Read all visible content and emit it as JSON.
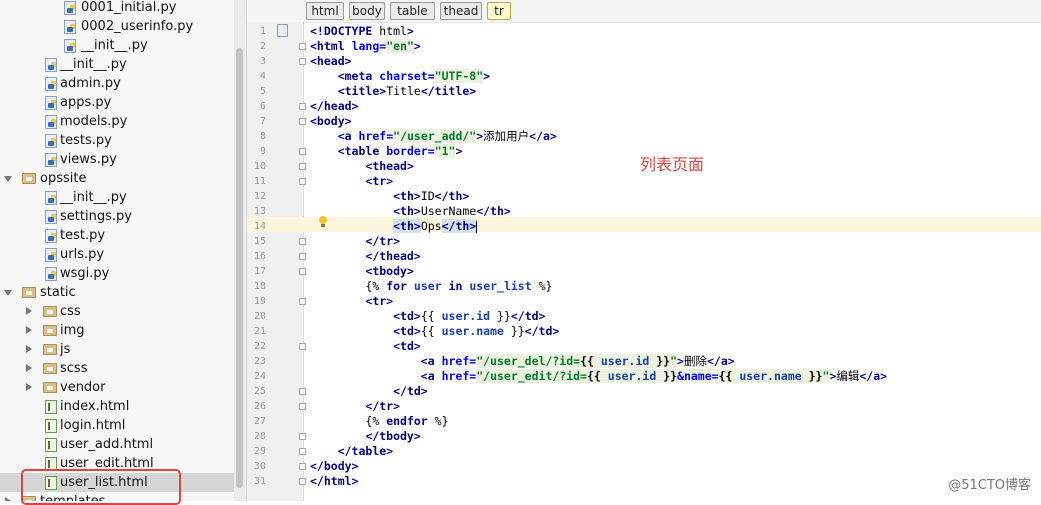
{
  "tree": {
    "items": [
      {
        "label": "0001_initial.py",
        "type": "py"
      },
      {
        "label": "0002_userinfo.py",
        "type": "py"
      },
      {
        "label": "__init__.py",
        "type": "py"
      },
      {
        "label": "__init__.py",
        "type": "py"
      },
      {
        "label": "admin.py",
        "type": "py"
      },
      {
        "label": "apps.py",
        "type": "py"
      },
      {
        "label": "models.py",
        "type": "py"
      },
      {
        "label": "tests.py",
        "type": "py"
      },
      {
        "label": "views.py",
        "type": "py"
      },
      {
        "label": "opssite",
        "type": "folder",
        "expanded": true
      },
      {
        "label": "__init__.py",
        "type": "py"
      },
      {
        "label": "settings.py",
        "type": "py"
      },
      {
        "label": "test.py",
        "type": "py"
      },
      {
        "label": "urls.py",
        "type": "py"
      },
      {
        "label": "wsgi.py",
        "type": "py"
      },
      {
        "label": "static",
        "type": "folder",
        "expanded": true
      },
      {
        "label": "css",
        "type": "folder",
        "expanded": false
      },
      {
        "label": "img",
        "type": "folder",
        "expanded": false
      },
      {
        "label": "js",
        "type": "folder",
        "expanded": false
      },
      {
        "label": "scss",
        "type": "folder",
        "expanded": false
      },
      {
        "label": "vendor",
        "type": "folder",
        "expanded": false
      },
      {
        "label": "index.html",
        "type": "html"
      },
      {
        "label": "login.html",
        "type": "html"
      },
      {
        "label": "user_add.html",
        "type": "html"
      },
      {
        "label": "user_edit.html",
        "type": "html"
      },
      {
        "label": "user_list.html",
        "type": "html",
        "selected": true
      },
      {
        "label": "templates",
        "type": "folder",
        "expanded": false
      }
    ]
  },
  "breadcrumbs": [
    "html",
    "body",
    "table",
    "thead",
    "tr"
  ],
  "editor": {
    "line_numbers": [
      "1",
      "2",
      "3",
      "4",
      "5",
      "6",
      "7",
      "8",
      "9",
      "10",
      "11",
      "12",
      "13",
      "14",
      "15",
      "16",
      "17",
      "18",
      "19",
      "20",
      "21",
      "22",
      "23",
      "24",
      "25",
      "26",
      "27",
      "28",
      "29",
      "30",
      "31"
    ],
    "lines": [
      "<!DOCTYPE html>",
      "<html lang=\"en\">",
      "<head>",
      "    <meta charset=\"UTF-8\">",
      "    <title>Title</title>",
      "</head>",
      "<body>",
      "    <a href=\"/user_add/\">添加用户</a>",
      "    <table border=\"1\">",
      "        <thead>",
      "        <tr>",
      "            <th>ID</th>",
      "            <th>UserName</th>",
      "            <th>Ops</th>",
      "        </tr>",
      "        </thead>",
      "        <tbody>",
      "        {% for user in user_list %}",
      "        <tr>",
      "            <td>{{ user.id }}</td>",
      "            <td>{{ user.name }}</td>",
      "            <td>",
      "                <a href=\"/user_del/?id={{ user.id }}\">删除</a>",
      "                <a href=\"/user_edit/?id={{ user.id }}&name={{ user.name }}\">编辑</a>",
      "            </td>",
      "        </tr>",
      "        {% endfor %}",
      "        </tbody>",
      "    </table>",
      "</body>",
      "</html>"
    ]
  },
  "annotation": "列表页面",
  "watermark": "@51CTO博客"
}
